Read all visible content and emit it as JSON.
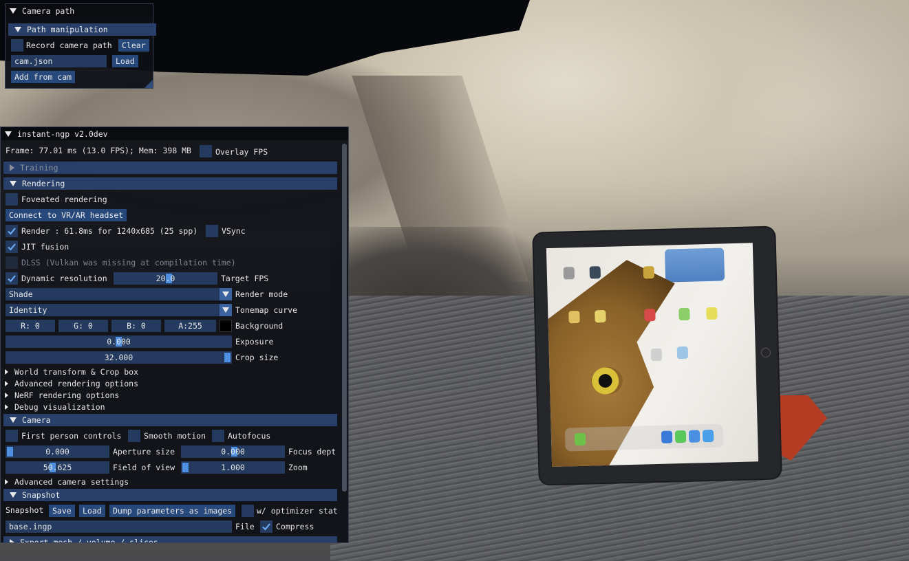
{
  "camera_path_window": {
    "title": "Camera path",
    "section": "Path manipulation",
    "record_label": "Record camera path",
    "clear_button": "Clear",
    "file_value": "cam.json",
    "load_button": "Load",
    "add_from_cam_button": "Add from cam"
  },
  "main_window": {
    "title": "instant-ngp v2.0dev",
    "frame_info": "Frame: 77.01 ms (13.0 FPS); Mem: 398 MB",
    "overlay_fps_label": "Overlay FPS",
    "training_header": "Training",
    "rendering": {
      "header": "Rendering",
      "foveated_label": "Foveated rendering",
      "vr_button": "Connect to VR/AR headset",
      "render_label": "Render : 61.8ms for 1240x685 (25 spp)",
      "vsync_label": "VSync",
      "jit_label": "JIT fusion",
      "dlss_label": "DLSS (Vulkan was missing at compilation time)",
      "dynamic_res_label": "Dynamic resolution",
      "target_fps_value": "20.0",
      "target_fps_label": "Target FPS",
      "render_mode_value": "Shade",
      "render_mode_label": "Render mode",
      "tonemap_value": "Identity",
      "tonemap_label": "Tonemap curve",
      "bg_r": "R:  0",
      "bg_g": "G:  0",
      "bg_b": "B:  0",
      "bg_a": "A:255",
      "background_label": "Background",
      "background_color": "#000000",
      "exposure_value": "0.000",
      "exposure_label": "Exposure",
      "crop_value": "32.000",
      "crop_label": "Crop size",
      "subsections": [
        "World transform & Crop box",
        "Advanced rendering options",
        "NeRF rendering options",
        "Debug visualization"
      ]
    },
    "camera": {
      "header": "Camera",
      "first_person_label": "First person controls",
      "smooth_motion_label": "Smooth motion",
      "autofocus_label": "Autofocus",
      "aperture_value": "0.000",
      "aperture_label": "Aperture size",
      "focus_value": "0.000",
      "focus_label": "Focus dept",
      "fov_value": "50.625",
      "fov_label": "Field of view",
      "zoom_value": "1.000",
      "zoom_label": "Zoom",
      "advanced_label": "Advanced camera settings"
    },
    "snapshot": {
      "header": "Snapshot",
      "row_label": "Snapshot",
      "save_button": "Save",
      "load_button": "Load",
      "dump_button": "Dump parameters as images",
      "optimizer_label": "w/ optimizer stat",
      "file_value": "base.ingp",
      "file_label": "File",
      "compress_label": "Compress"
    },
    "export_header": "Export mesh / volume / slices"
  }
}
